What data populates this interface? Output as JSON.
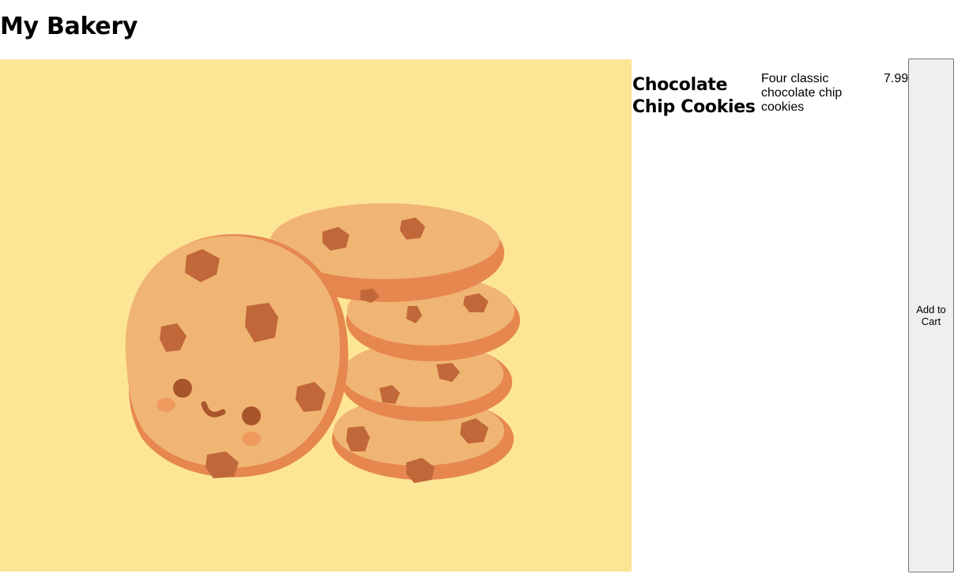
{
  "header": {
    "title": "My Bakery"
  },
  "product": {
    "image_icon": "chocolate-chip-cookies-illustration",
    "name": "Chocolate Chip Cookies",
    "description": "Four classic chocolate chip cookies",
    "price": "7.99",
    "button_label": "Add to Cart"
  },
  "colors": {
    "image_background": "#fde596",
    "cookie_light": "#f0b572",
    "cookie_edge": "#e6874f",
    "chip": "#c06839",
    "button_background": "#efefef"
  }
}
